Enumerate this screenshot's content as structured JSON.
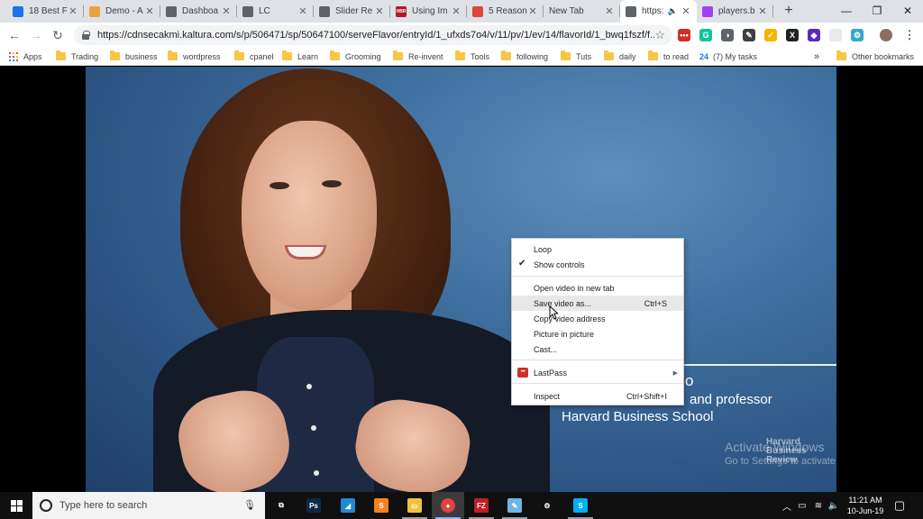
{
  "window": {
    "minimize": "—",
    "restore": "❐",
    "close": "✕"
  },
  "tabs": [
    {
      "title": "18 Best F",
      "favicon_color": "#1a73e8",
      "favicon_text": ""
    },
    {
      "title": "Demo - A",
      "favicon_color": "#e8a33d",
      "favicon_text": ""
    },
    {
      "title": "Dashboa",
      "favicon_color": "#5f6368",
      "favicon_text": ""
    },
    {
      "title": "LC",
      "favicon_color": "#5f6368",
      "favicon_text": ""
    },
    {
      "title": "Slider Re",
      "favicon_color": "#5f6368",
      "favicon_text": ""
    },
    {
      "title": "Using Im",
      "favicon_color": "#b3162a",
      "favicon_text": "HBR"
    },
    {
      "title": "5 Reason",
      "favicon_color": "#e0443e",
      "favicon_text": ""
    },
    {
      "title": "New Tab",
      "favicon_color": "",
      "favicon_text": ""
    },
    {
      "title": "https:",
      "favicon_color": "#5f6368",
      "favicon_text": "",
      "active": true,
      "audio": "🔈"
    },
    {
      "title": "players.b",
      "favicon_color": "#a142f4",
      "favicon_text": ""
    }
  ],
  "new_tab_label": "+",
  "toolbar": {
    "url": "https://cdnsecakmi.kaltura.com/s/p/506471/sp/50647100/serveFlavor/entryId/1_ufxds7o4/v/11/pv/1/ev/14/flavorId/1_bwq1fszf/f...",
    "star": "☆",
    "back": "←",
    "forward": "→",
    "reload": "↻"
  },
  "extensions": [
    {
      "label": "•••",
      "color": "#d32d27"
    },
    {
      "label": "G",
      "color": "#15c39a"
    },
    {
      "label": "◑",
      "color": "#5f6368"
    },
    {
      "label": "✎",
      "color": "#3c4043"
    },
    {
      "label": "✓",
      "color": "#f5b400"
    },
    {
      "label": "X",
      "color": "#202124"
    },
    {
      "label": "◆",
      "color": "#5b2ab8"
    },
    {
      "label": "",
      "color": "#e8eaed"
    },
    {
      "label": "⚙",
      "color": "#34a8c9"
    },
    {
      "label": "",
      "color": "#8d6e63"
    },
    {
      "label": "⋮",
      "color": "#5f6368"
    }
  ],
  "bookmarks": {
    "apps_label": "Apps",
    "items": [
      "Trading",
      "business",
      "wordpress",
      "cpanel",
      "Learn",
      "Grooming",
      "Re-invent",
      "Tools",
      "following",
      "Tuts",
      "daily",
      "to read"
    ],
    "tasks_badge": "24",
    "tasks_label": "(7) My tasks",
    "overflow": "»",
    "other_label": "Other bookmarks"
  },
  "video": {
    "caption_line1_suffix": "o",
    "caption_line2": "and professor",
    "caption_line3": "Harvard Business School",
    "activate_title": "Activate Windows",
    "activate_sub": "Go to Settings to activate Windows.",
    "logo_line1": "Harvard",
    "logo_line2": "Business",
    "logo_line3": "Review"
  },
  "context_menu": {
    "loop": "Loop",
    "show_controls": "Show controls",
    "check_mark": "✔",
    "open_new_tab": "Open video in new tab",
    "save_video": "Save video as...",
    "save_shortcut": "Ctrl+S",
    "copy_address": "Copy video address",
    "picture_in_picture": "Picture in picture",
    "cast": "Cast...",
    "lastpass": "LastPass",
    "lastpass_icon": "•••",
    "submenu_arrow": "▶",
    "inspect": "Inspect",
    "inspect_shortcut": "Ctrl+Shift+I"
  },
  "taskbar": {
    "search_placeholder": "Type here to search",
    "apps": [
      {
        "name": "task-view",
        "label": "⧉",
        "color": "#101010"
      },
      {
        "name": "photoshop",
        "label": "Ps",
        "color": "#0b2a4a"
      },
      {
        "name": "vscode",
        "label": "◢",
        "color": "#1f8ad2"
      },
      {
        "name": "sublime",
        "label": "S",
        "color": "#f5821f"
      },
      {
        "name": "file-explorer",
        "label": "▭",
        "color": "#f3c23c"
      },
      {
        "name": "chrome",
        "label": "●",
        "color": "#e0443e"
      },
      {
        "name": "filezilla",
        "label": "FZ",
        "color": "#bf1e23"
      },
      {
        "name": "notepad",
        "label": "✎",
        "color": "#6fb6e8"
      },
      {
        "name": "settings",
        "label": "⚙",
        "color": "#101010"
      },
      {
        "name": "skype",
        "label": "S",
        "color": "#00aff0"
      }
    ],
    "tray_up": "︿",
    "tray_battery": "▭",
    "tray_wifi": "≋",
    "tray_volume": "🔈",
    "time": "11:21 AM",
    "date": "10-Jun-19",
    "notifications": "▢"
  }
}
